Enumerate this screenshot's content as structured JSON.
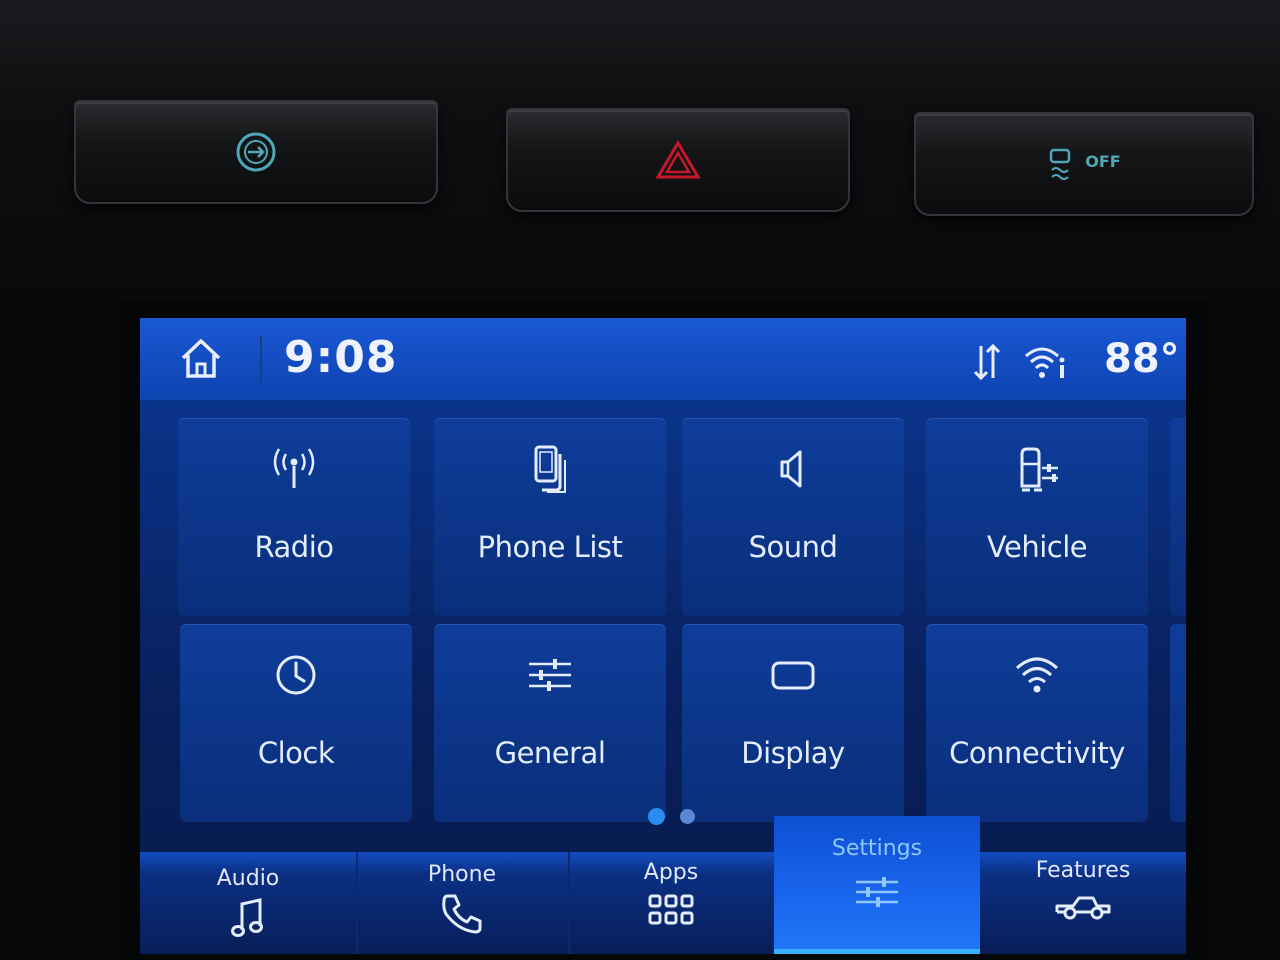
{
  "status": {
    "time": "9:08",
    "temperature": "88°"
  },
  "tiles": [
    {
      "label": "Radio",
      "icon": "radio-antenna-icon"
    },
    {
      "label": "Phone List",
      "icon": "phone-list-icon"
    },
    {
      "label": "Sound",
      "icon": "speaker-icon"
    },
    {
      "label": "Vehicle",
      "icon": "vehicle-settings-icon"
    },
    {
      "label": "Clock",
      "icon": "clock-icon"
    },
    {
      "label": "General",
      "icon": "sliders-icon"
    },
    {
      "label": "Display",
      "icon": "display-icon"
    },
    {
      "label": "Connectivity",
      "icon": "wifi-icon"
    }
  ],
  "pagination": {
    "current": 1,
    "total": 2
  },
  "nav": [
    {
      "label": "Audio",
      "icon": "music-note-icon"
    },
    {
      "label": "Phone",
      "icon": "phone-handset-icon"
    },
    {
      "label": "Apps",
      "icon": "apps-grid-icon"
    },
    {
      "label": "Settings",
      "icon": "settings-sliders-icon",
      "active": true
    },
    {
      "label": "Features",
      "icon": "truck-icon"
    }
  ],
  "hardware": {
    "left_icon": "touch-control-icon",
    "center_icon": "hazard-warning-icon",
    "right_icon": "traction-control-off-icon",
    "right_text": "OFF"
  },
  "colors": {
    "screen_blue": "#0a2c79",
    "status_bar": "#1a58d4",
    "active_tab": "#1f78f8",
    "active_label": "#8fc7ff",
    "hazard_red": "#c8162a",
    "hw_icon_teal": "#4fa8b8"
  }
}
